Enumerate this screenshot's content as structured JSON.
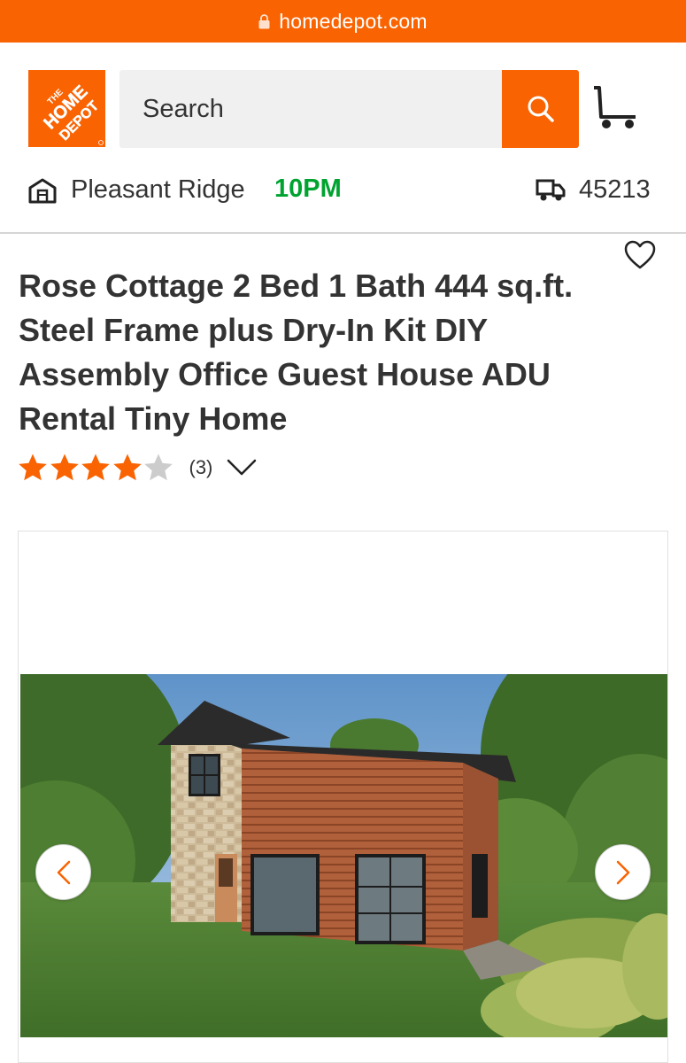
{
  "browser": {
    "url": "homedepot.com"
  },
  "header": {
    "logo_text": "THE HOME DEPOT",
    "search": {
      "placeholder": "Search",
      "value": ""
    },
    "store": {
      "name": "Pleasant Ridge",
      "hours": "10PM"
    },
    "delivery": {
      "zip": "45213"
    }
  },
  "product": {
    "title": "Rose Cottage 2 Bed 1 Bath 444 sq.ft. Steel Frame plus Dry-In Kit DIY Assembly Office Guest House ADU Rental Tiny Home",
    "rating": {
      "value": 4,
      "max": 5,
      "count_label": "(3)"
    }
  },
  "icons": {
    "lock": "lock-icon",
    "search": "search-icon",
    "cart": "cart-icon",
    "store": "store-icon",
    "truck": "truck-icon",
    "favorite": "heart-icon",
    "star": "star-icon",
    "expand": "chevron-down-icon",
    "prev": "chevron-left-icon",
    "next": "chevron-right-icon"
  },
  "colors": {
    "brand": "#f96302",
    "open_hours": "#00a330",
    "star_filled": "#f96302",
    "star_empty": "#cccccc"
  }
}
